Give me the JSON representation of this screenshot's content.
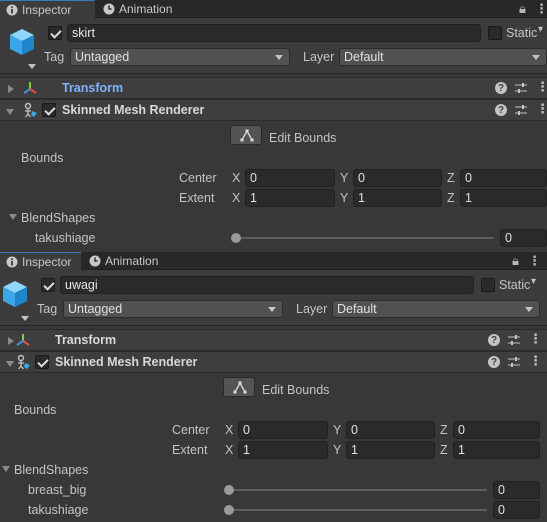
{
  "panels": [
    {
      "tabs": {
        "inspector": "Inspector",
        "animation": "Animation"
      },
      "object": {
        "name": "skirt",
        "active": true,
        "static_label": "Static",
        "static": false
      },
      "tag": {
        "label": "Tag",
        "value": "Untagged"
      },
      "layer": {
        "label": "Layer",
        "value": "Default"
      },
      "transform": {
        "title": "Transform"
      },
      "smr": {
        "title": "Skinned Mesh Renderer",
        "enabled": true,
        "edit_bounds": "Edit Bounds",
        "bounds_label": "Bounds",
        "center": {
          "label": "Center",
          "x": "0",
          "y": "0",
          "z": "0"
        },
        "extent": {
          "label": "Extent",
          "x": "1",
          "y": "1",
          "z": "1"
        },
        "axis": {
          "x": "X",
          "y": "Y",
          "z": "Z"
        },
        "blendshapes_label": "BlendShapes",
        "blendshapes": [
          {
            "name": "takushiage",
            "value": "0"
          }
        ]
      }
    },
    {
      "tabs": {
        "inspector": "Inspector",
        "animation": "Animation"
      },
      "object": {
        "name": "uwagi",
        "active": true,
        "static_label": "Static",
        "static": false
      },
      "tag": {
        "label": "Tag",
        "value": "Untagged"
      },
      "layer": {
        "label": "Layer",
        "value": "Default"
      },
      "transform": {
        "title": "Transform"
      },
      "smr": {
        "title": "Skinned Mesh Renderer",
        "enabled": true,
        "edit_bounds": "Edit Bounds",
        "bounds_label": "Bounds",
        "center": {
          "label": "Center",
          "x": "0",
          "y": "0",
          "z": "0"
        },
        "extent": {
          "label": "Extent",
          "x": "1",
          "y": "1",
          "z": "1"
        },
        "axis": {
          "x": "X",
          "y": "Y",
          "z": "Z"
        },
        "blendshapes_label": "BlendShapes",
        "blendshapes": [
          {
            "name": "breast_big",
            "value": "0"
          },
          {
            "name": "takushiage",
            "value": "0"
          }
        ]
      }
    }
  ],
  "colors": {
    "accent_tab": "#3a79bb",
    "panel_bg": "#383838",
    "transform_title": "#7fb2ff"
  }
}
